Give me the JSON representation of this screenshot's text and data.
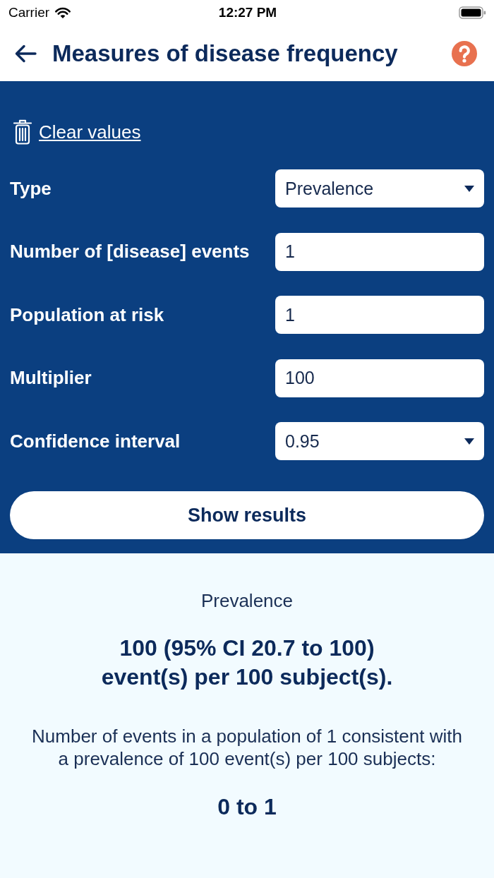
{
  "status_bar": {
    "carrier": "Carrier",
    "time": "12:27 PM"
  },
  "header": {
    "title": "Measures of disease frequency"
  },
  "form": {
    "clear_link": "Clear values",
    "fields": [
      {
        "kind": "select",
        "label": "Type",
        "value": "Prevalence"
      },
      {
        "kind": "input",
        "label": "Number of [disease] events",
        "value": "1"
      },
      {
        "kind": "input",
        "label": "Population at risk",
        "value": "1"
      },
      {
        "kind": "input",
        "label": "Multiplier",
        "value": "100"
      },
      {
        "kind": "select",
        "label": "Confidence interval",
        "value": "0.95"
      }
    ],
    "submit": "Show results"
  },
  "results": {
    "heading": "Prevalence",
    "estimate": "100 (95% CI 20.7 to 100) event(s) per 100 subject(s).",
    "description": "Number of events in a population of 1 consistent with a prevalence of 100 event(s) per 100 subjects:",
    "range": "0 to 1"
  }
}
